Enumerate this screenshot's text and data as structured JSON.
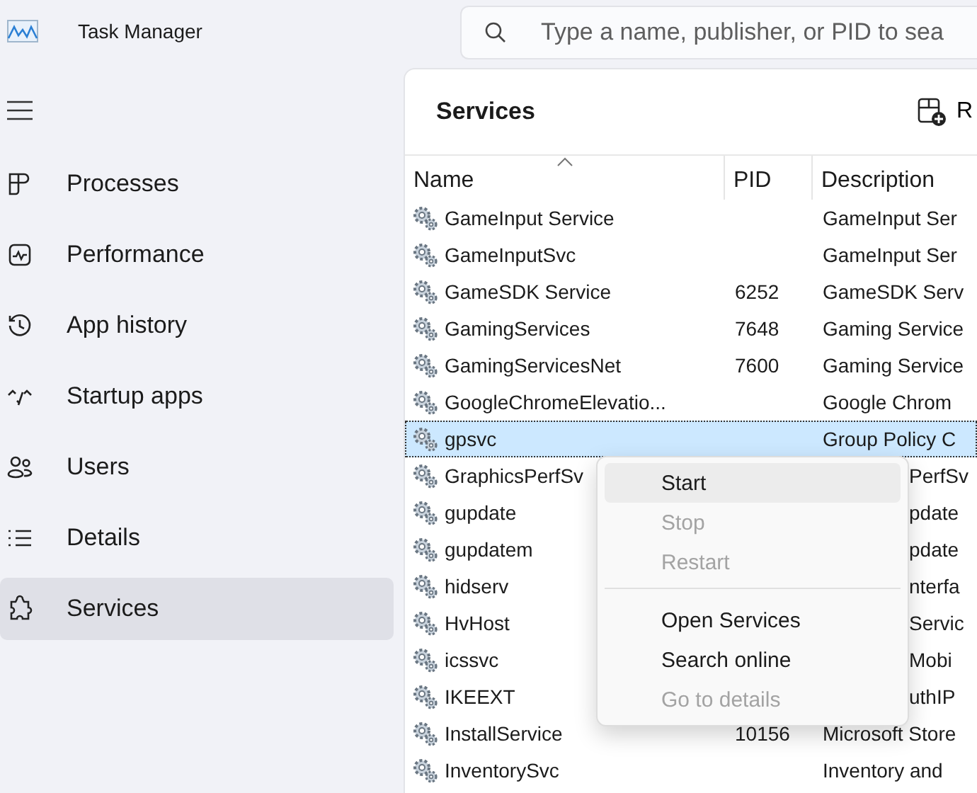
{
  "window": {
    "title": "Task Manager"
  },
  "search": {
    "placeholder": "Type a name, publisher, or PID to sea"
  },
  "sidebar": {
    "items": [
      {
        "label": "Processes",
        "selected": false
      },
      {
        "label": "Performance",
        "selected": false
      },
      {
        "label": "App history",
        "selected": false
      },
      {
        "label": "Startup apps",
        "selected": false
      },
      {
        "label": "Users",
        "selected": false
      },
      {
        "label": "Details",
        "selected": false
      },
      {
        "label": "Services",
        "selected": true
      }
    ]
  },
  "page": {
    "title": "Services",
    "toolbar_button": "R"
  },
  "table": {
    "columns": [
      "Name",
      "PID",
      "Description"
    ],
    "rows": [
      {
        "name": "GameInput Service",
        "pid": "",
        "description": "GameInput Ser",
        "selected": false,
        "under_menu": false
      },
      {
        "name": "GameInputSvc",
        "pid": "",
        "description": "GameInput Ser",
        "selected": false,
        "under_menu": false
      },
      {
        "name": "GameSDK Service",
        "pid": "6252",
        "description": "GameSDK Serv",
        "selected": false,
        "under_menu": false
      },
      {
        "name": "GamingServices",
        "pid": "7648",
        "description": "Gaming Service",
        "selected": false,
        "under_menu": false
      },
      {
        "name": "GamingServicesNet",
        "pid": "7600",
        "description": "Gaming Service",
        "selected": false,
        "under_menu": false
      },
      {
        "name": "GoogleChromeElevatio...",
        "pid": "",
        "description": "Google Chrom",
        "selected": false,
        "under_menu": false
      },
      {
        "name": "gpsvc",
        "pid": "",
        "description": "Group Policy C",
        "selected": true,
        "under_menu": false
      },
      {
        "name": "GraphicsPerfSv",
        "pid": "",
        "description": "PerfSv",
        "selected": false,
        "under_menu": true
      },
      {
        "name": "gupdate",
        "pid": "",
        "description": "pdate",
        "selected": false,
        "under_menu": true
      },
      {
        "name": "gupdatem",
        "pid": "",
        "description": "pdate",
        "selected": false,
        "under_menu": true
      },
      {
        "name": "hidserv",
        "pid": "",
        "description": "nterfa",
        "selected": false,
        "under_menu": true
      },
      {
        "name": "HvHost",
        "pid": "",
        "description": "Servic",
        "selected": false,
        "under_menu": true
      },
      {
        "name": "icssvc",
        "pid": "",
        "description": "Mobi",
        "selected": false,
        "under_menu": true
      },
      {
        "name": "IKEEXT",
        "pid": "",
        "description": "uthIP",
        "selected": false,
        "under_menu": true
      },
      {
        "name": "InstallService",
        "pid": "10156",
        "description": "Microsoft Store",
        "selected": false,
        "under_menu": false
      },
      {
        "name": "InventorySvc",
        "pid": "",
        "description": "Inventory and",
        "selected": false,
        "under_menu": false
      }
    ]
  },
  "context_menu": {
    "items": [
      {
        "kind": "item",
        "label": "Start",
        "disabled": false,
        "hovered": true
      },
      {
        "kind": "item",
        "label": "Stop",
        "disabled": true,
        "hovered": false
      },
      {
        "kind": "item",
        "label": "Restart",
        "disabled": true,
        "hovered": false
      },
      {
        "kind": "separator"
      },
      {
        "kind": "item",
        "label": "Open Services",
        "disabled": false,
        "hovered": false
      },
      {
        "kind": "item",
        "label": "Search online",
        "disabled": false,
        "hovered": false
      },
      {
        "kind": "item",
        "label": "Go to details",
        "disabled": true,
        "hovered": false
      }
    ]
  }
}
